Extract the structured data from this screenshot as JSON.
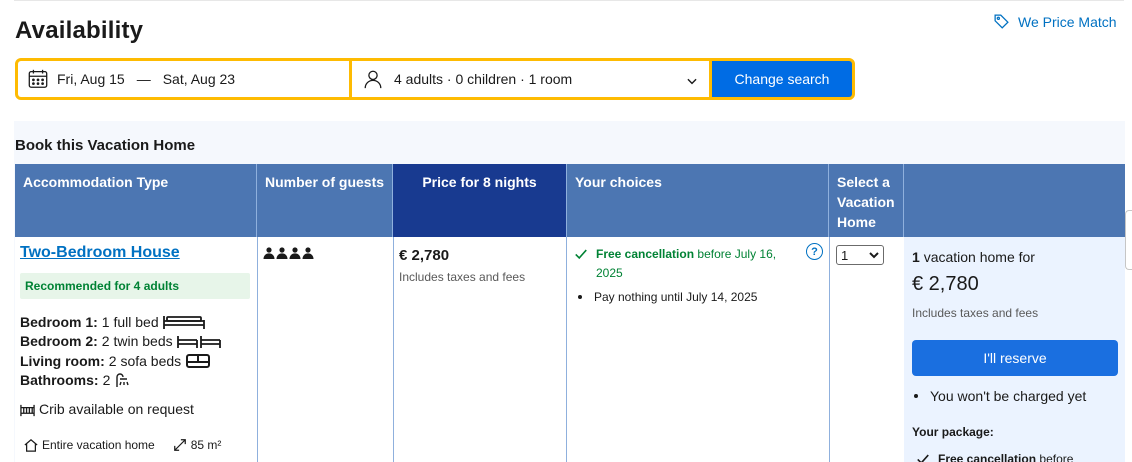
{
  "header": {
    "title": "Availability",
    "price_match_label": "We Price Match"
  },
  "search": {
    "check_in": "Fri, Aug 15",
    "separator": "—",
    "check_out": "Sat, Aug 23",
    "guests": "4 adults · 0 children · 1 room",
    "button_label": "Change search"
  },
  "section": {
    "title": "Book this Vacation Home"
  },
  "table": {
    "headers": {
      "accommodation_type": "Accommodation Type",
      "number_of_guests": "Number of guests",
      "price": "Price for 8 nights",
      "your_choices": "Your choices",
      "select_line1": "Select a",
      "select_line2": "Vacation",
      "select_line3": "Home",
      "last": ""
    },
    "row": {
      "room_name": "Two-Bedroom House",
      "recommended": "Recommended for 4 adults",
      "beds": [
        {
          "label": "Bedroom 1:",
          "value": "1 full bed",
          "icon": "full-bed-icon"
        },
        {
          "label": "Bedroom 2:",
          "value": "2 twin beds",
          "icon": "twin-beds-icon"
        },
        {
          "label": "Living room:",
          "value": "2 sofa beds",
          "icon": "sofa-bed-icon"
        },
        {
          "label": "Bathrooms:",
          "value": "2",
          "icon": "shower-icon"
        }
      ],
      "crib": "Crib available on request",
      "property_type": "Entire vacation home",
      "size": "85 m²",
      "guest_count": 4,
      "price": "€ 2,780",
      "price_note": "Includes taxes and fees",
      "free_cancellation": "Free cancellation",
      "cancellation_deadline": "before July 16, 2025",
      "pay_nothing": "Pay nothing until July 14, 2025",
      "help_icon": "?",
      "selected_quantity": "1"
    }
  },
  "reserve": {
    "count": "1",
    "count_suffix": "vacation home for",
    "price": "€ 2,780",
    "price_note": "Includes taxes and fees",
    "button_label": "I'll reserve",
    "no_charge": "You won't be charged yet",
    "package_title": "Your package:",
    "package_free_cancellation": "Free cancellation",
    "package_before": "before"
  },
  "colors": {
    "brand_blue": "#006ce4",
    "link_blue": "#0071c2",
    "header_blue": "#4c76b2",
    "header_dark": "#183a90",
    "search_border": "#febb02",
    "green": "#008234"
  }
}
